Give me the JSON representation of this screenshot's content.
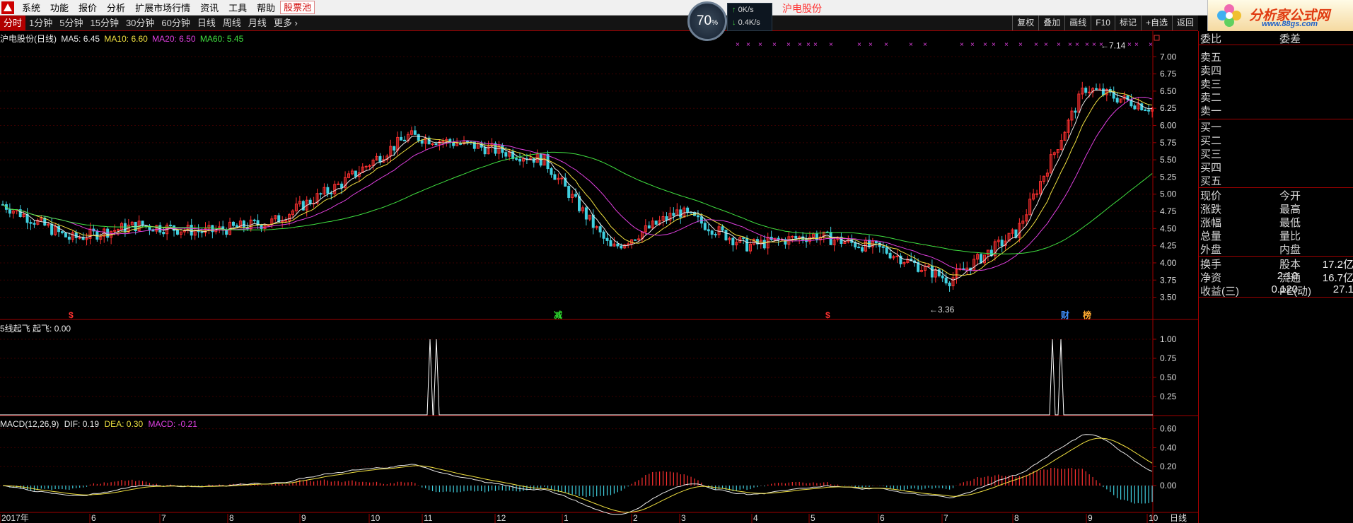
{
  "menu": {
    "items": [
      "系统",
      "功能",
      "报价",
      "分析",
      "扩展市场行情",
      "资讯",
      "工具",
      "帮助"
    ],
    "hot": "股票池"
  },
  "brand": {
    "name": "分析家公式网",
    "url": "www.88gs.com"
  },
  "toolbar": {
    "tabs": [
      "分时",
      "1分钟",
      "5分钟",
      "15分钟",
      "30分钟",
      "60分钟",
      "日线",
      "周线",
      "月线",
      "更多 ›"
    ],
    "active_tab": "分时",
    "right_buttons": [
      "复权",
      "叠加",
      "画线",
      "F10",
      "标记",
      "+自选",
      "返回"
    ]
  },
  "network": {
    "percent": "70",
    "percent_unit": "%",
    "up": "0K/s",
    "down": "0.4K/s"
  },
  "stock_title": "沪电股份",
  "main_chart": {
    "header_name": "沪电股份(日线)",
    "ma": [
      {
        "label": "MA5:",
        "value": "6.45",
        "color": "#e8e8e8"
      },
      {
        "label": "MA10:",
        "value": "6.60",
        "color": "#f0e040"
      },
      {
        "label": "MA20:",
        "value": "6.50",
        "color": "#e040e0"
      },
      {
        "label": "MA60:",
        "value": "5.45",
        "color": "#40e040"
      }
    ],
    "y_ticks": [
      "7.00",
      "6.75",
      "6.50",
      "6.25",
      "6.00",
      "5.75",
      "5.50",
      "5.25",
      "5.00",
      "4.75",
      "4.50",
      "4.25",
      "4.00",
      "3.75",
      "3.50"
    ],
    "high_marker": "7.14",
    "low_marker": "3.36",
    "event_marks": [
      {
        "text": "$",
        "color": "#ff3030"
      },
      {
        "text": "减",
        "color": "#30e030"
      },
      {
        "text": "$",
        "color": "#ff3030"
      },
      {
        "text": "财",
        "color": "#4090ff"
      },
      {
        "text": "榜",
        "color": "#ffaa30"
      }
    ]
  },
  "indicator1": {
    "name": "5线起飞",
    "param": "起飞:",
    "value": "0.00",
    "y_ticks": [
      "1.00",
      "0.75",
      "0.50",
      "0.25"
    ]
  },
  "macd": {
    "name": "MACD(12,26,9)",
    "dif_label": "DIF:",
    "dif": "0.19",
    "dea_label": "DEA:",
    "dea": "0.30",
    "macd_label": "MACD:",
    "macd": "-0.21",
    "y_ticks": [
      "0.60",
      "0.40",
      "0.20",
      "0.00"
    ]
  },
  "x_axis": {
    "labels": [
      "2017年",
      "6",
      "7",
      "8",
      "9",
      "10",
      "11",
      "12",
      "1",
      "2",
      "3",
      "4",
      "5",
      "6",
      "7",
      "8",
      "9",
      "10"
    ],
    "period": "日线"
  },
  "quote": {
    "wei": {
      "k": "委比",
      "k2": "委差"
    },
    "sell": [
      "卖五",
      "卖四",
      "卖三",
      "卖二",
      "卖一"
    ],
    "buy": [
      "买一",
      "买二",
      "买三",
      "买四",
      "买五"
    ],
    "stats1": [
      {
        "k": "现价",
        "k2": "今开"
      },
      {
        "k": "涨跌",
        "k2": "最高"
      },
      {
        "k": "涨幅",
        "k2": "最低"
      },
      {
        "k": "总量",
        "k2": "量比"
      },
      {
        "k": "外盘",
        "k2": "内盘"
      }
    ],
    "stats2": [
      {
        "k": "换手",
        "v": "",
        "k2": "股本",
        "v2": "17.2亿"
      },
      {
        "k": "净资",
        "v": "2.10",
        "k2": "流通",
        "v2": "16.7亿"
      },
      {
        "k": "收益(三)",
        "v": "0.120",
        "k2": "PE(动)",
        "v2": "27.1"
      }
    ]
  },
  "colors": {
    "up": "#ff3030",
    "down": "#40d0e0",
    "frame": "#a00000"
  },
  "chart_data": {
    "type": "candlestick",
    "title": "沪电股份(日线)",
    "y_range": [
      3.36,
      7.14
    ],
    "x_period": "2017年5月 - 2018年10月",
    "close_trend": [
      {
        "month": "2017-05",
        "close": 4.85
      },
      {
        "month": "2017-06",
        "close": 4.35
      },
      {
        "month": "2017-07",
        "close": 4.55
      },
      {
        "month": "2017-08",
        "close": 4.45
      },
      {
        "month": "2017-09",
        "close": 4.6
      },
      {
        "month": "2017-10",
        "close": 5.15
      },
      {
        "month": "2017-11",
        "close": 5.85
      },
      {
        "month": "2017-12",
        "close": 5.7
      },
      {
        "month": "2018-01",
        "close": 5.5
      },
      {
        "month": "2018-02",
        "close": 4.2
      },
      {
        "month": "2018-03",
        "close": 4.75
      },
      {
        "month": "2018-04",
        "close": 4.25
      },
      {
        "month": "2018-05",
        "close": 4.4
      },
      {
        "month": "2018-06",
        "close": 4.2
      },
      {
        "month": "2018-07",
        "close": 3.75
      },
      {
        "month": "2018-08",
        "close": 4.45
      },
      {
        "month": "2018-09",
        "close": 6.55
      },
      {
        "month": "2018-10",
        "close": 6.25
      }
    ]
  }
}
